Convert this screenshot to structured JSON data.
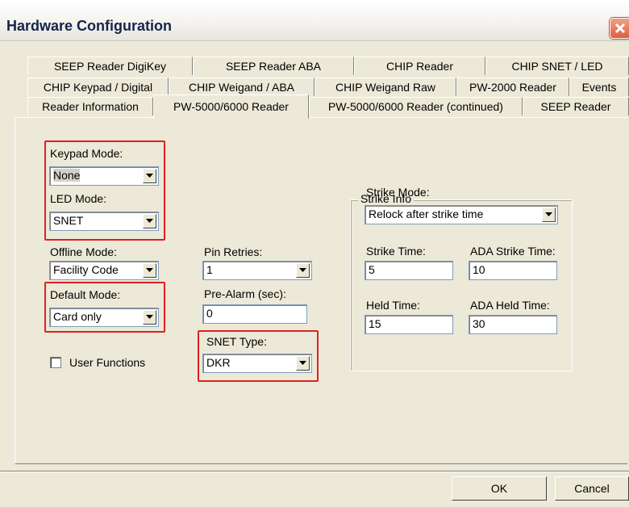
{
  "window": {
    "title": "Hardware Configuration"
  },
  "tabs": {
    "row1": [
      "SEEP Reader DigiKey",
      "SEEP Reader ABA",
      "CHIP Reader",
      "CHIP SNET / LED"
    ],
    "row2": [
      "CHIP Keypad / Digital",
      "CHIP Weigand / ABA",
      "CHIP Weigand Raw",
      "PW-2000 Reader",
      "Events"
    ],
    "row3": [
      "Reader Information",
      "PW-5000/6000 Reader",
      "PW-5000/6000 Reader (continued)",
      "SEEP Reader"
    ],
    "active": "PW-5000/6000 Reader"
  },
  "fields": {
    "keypad_mode": {
      "label": "Keypad Mode:",
      "value": "None"
    },
    "led_mode": {
      "label": "LED Mode:",
      "value": "SNET"
    },
    "offline_mode": {
      "label": "Offline Mode:",
      "value": "Facility Code"
    },
    "default_mode": {
      "label": "Default Mode:",
      "value": "Card only"
    },
    "user_functions": {
      "label": "User Functions",
      "checked": false
    },
    "pin_retries": {
      "label": "Pin Retries:",
      "value": "1"
    },
    "pre_alarm": {
      "label": "Pre-Alarm (sec):",
      "value": "0"
    },
    "snet_type": {
      "label": "SNET Type:",
      "value": "DKR"
    }
  },
  "strike_info": {
    "title": "Strike Info",
    "strike_mode": {
      "label": "Strike Mode:",
      "value": "Relock after strike time"
    },
    "strike_time": {
      "label": "Strike Time:",
      "value": "5"
    },
    "ada_strike_time": {
      "label": "ADA Strike Time:",
      "value": "10"
    },
    "held_time": {
      "label": "Held Time:",
      "value": "15"
    },
    "ada_held_time": {
      "label": "ADA Held Time:",
      "value": "30"
    }
  },
  "buttons": {
    "ok": "OK",
    "cancel": "Cancel"
  },
  "highlight_color": "#e02020"
}
